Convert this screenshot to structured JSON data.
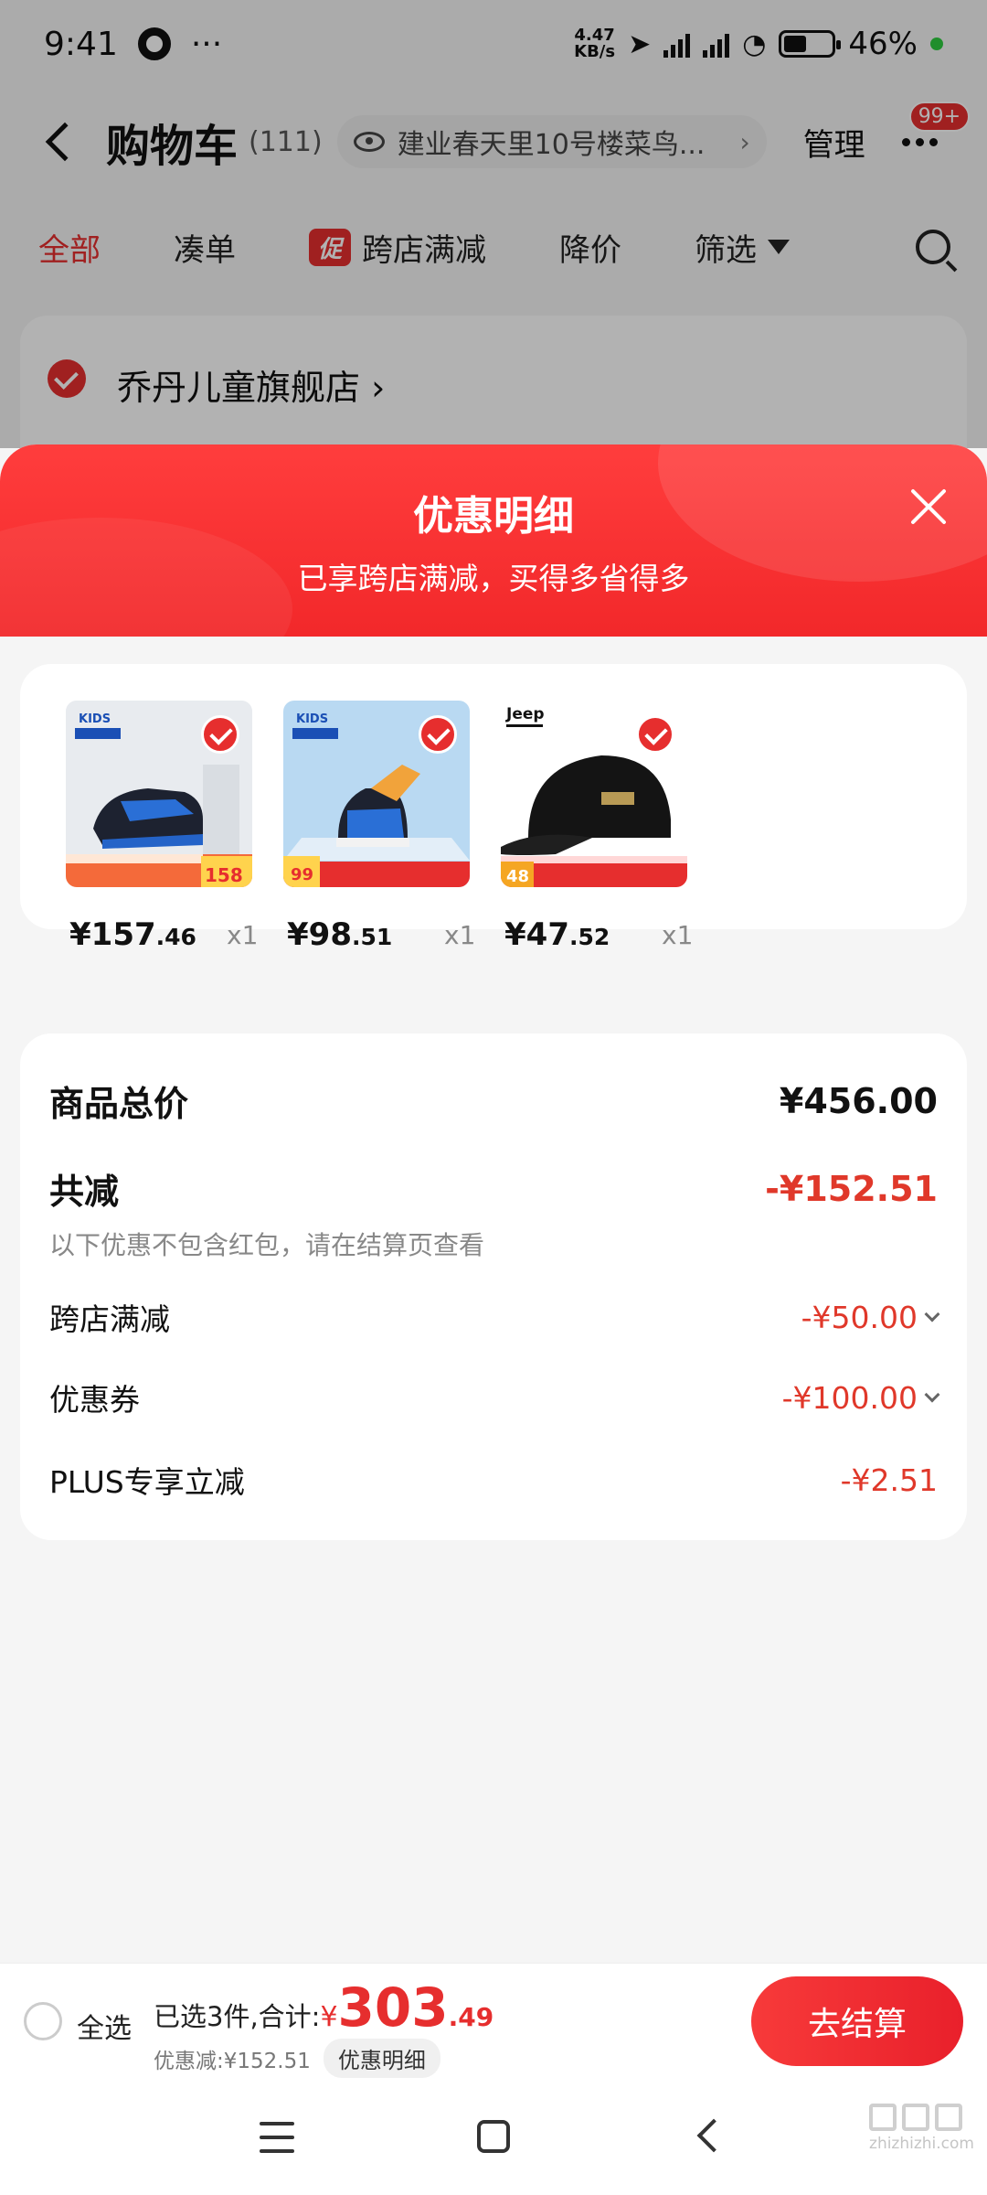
{
  "status_bar": {
    "time": "9:41",
    "more": "···",
    "net_speed": "4.47",
    "net_unit": "KB/s",
    "battery": "46%"
  },
  "cart_header": {
    "title": "购物车",
    "count": "(111)",
    "address": "建业春天里10号楼菜鸟...",
    "address_arrow": "›",
    "manage": "管理",
    "badge": "99+"
  },
  "filter_tabs": {
    "all": "全部",
    "combine": "凑单",
    "promo_tag": "促",
    "cross_store": "跨店满减",
    "price_drop": "降价",
    "filter": "筛选"
  },
  "store": {
    "name": "乔丹儿童旗舰店 ›"
  },
  "sheet": {
    "title": "优惠明细",
    "subtitle": "已享跨店满减，买得多省得多"
  },
  "products": [
    {
      "price_int": "¥157",
      "price_dec": ".46",
      "qty": "x1",
      "img_tag": "158",
      "brand": "KIDS"
    },
    {
      "price_int": "¥98",
      "price_dec": ".51",
      "qty": "x1",
      "img_tag": "99",
      "brand": "KIDS"
    },
    {
      "price_int": "¥47",
      "price_dec": ".52",
      "qty": "x1",
      "img_tag": "48",
      "brand": "Jeep"
    }
  ],
  "details": {
    "total_label": "商品总价",
    "total_value": "¥456.00",
    "reduce_label": "共减",
    "reduce_value": "-¥152.51",
    "note": "以下优惠不包含红包，请在结算页查看",
    "items": [
      {
        "label": "跨店满减",
        "value": "-¥50.00",
        "expandable": true
      },
      {
        "label": "优惠券",
        "value": "-¥100.00",
        "expandable": true
      },
      {
        "label": "PLUS专享立减",
        "value": "-¥2.51",
        "expandable": false
      }
    ]
  },
  "bottom_bar": {
    "select_all": "全选",
    "selected_text": "已选3件,合计:",
    "currency": "¥",
    "total_int": "303",
    "total_dec": ".49",
    "discount_text": "优惠减:¥152.51",
    "discount_detail": "优惠明细",
    "checkout": "去结算"
  },
  "watermark": "zhizhizhi.com",
  "colors": {
    "accent_red": "#e62e2e",
    "sheet_header": "#f2282a",
    "background": "#f5f5f5"
  }
}
